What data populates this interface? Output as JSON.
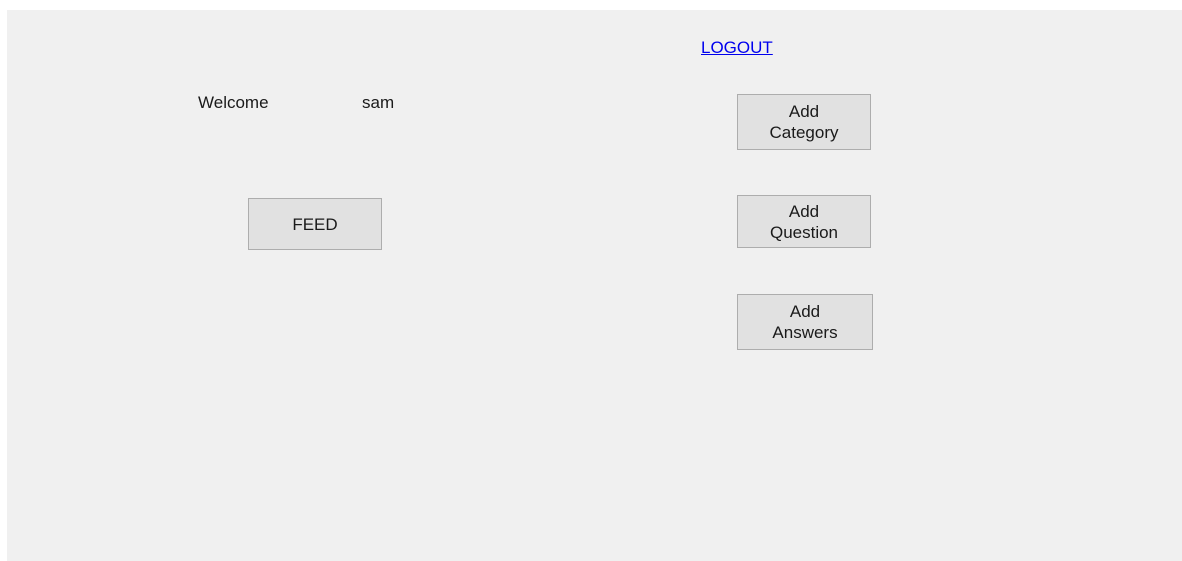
{
  "header": {
    "logout_label": "LOGOUT"
  },
  "greeting": {
    "welcome_label": "Welcome",
    "username": "sam"
  },
  "actions": {
    "feed_label": "FEED",
    "add_category_label": "Add\nCategory",
    "add_question_label": "Add\nQuestion",
    "add_answers_label": "Add\nAnswers"
  },
  "colors": {
    "form_background": "#f0f0f0",
    "button_background": "#e1e1e1",
    "button_border": "#adadad",
    "link": "#0000ee"
  }
}
